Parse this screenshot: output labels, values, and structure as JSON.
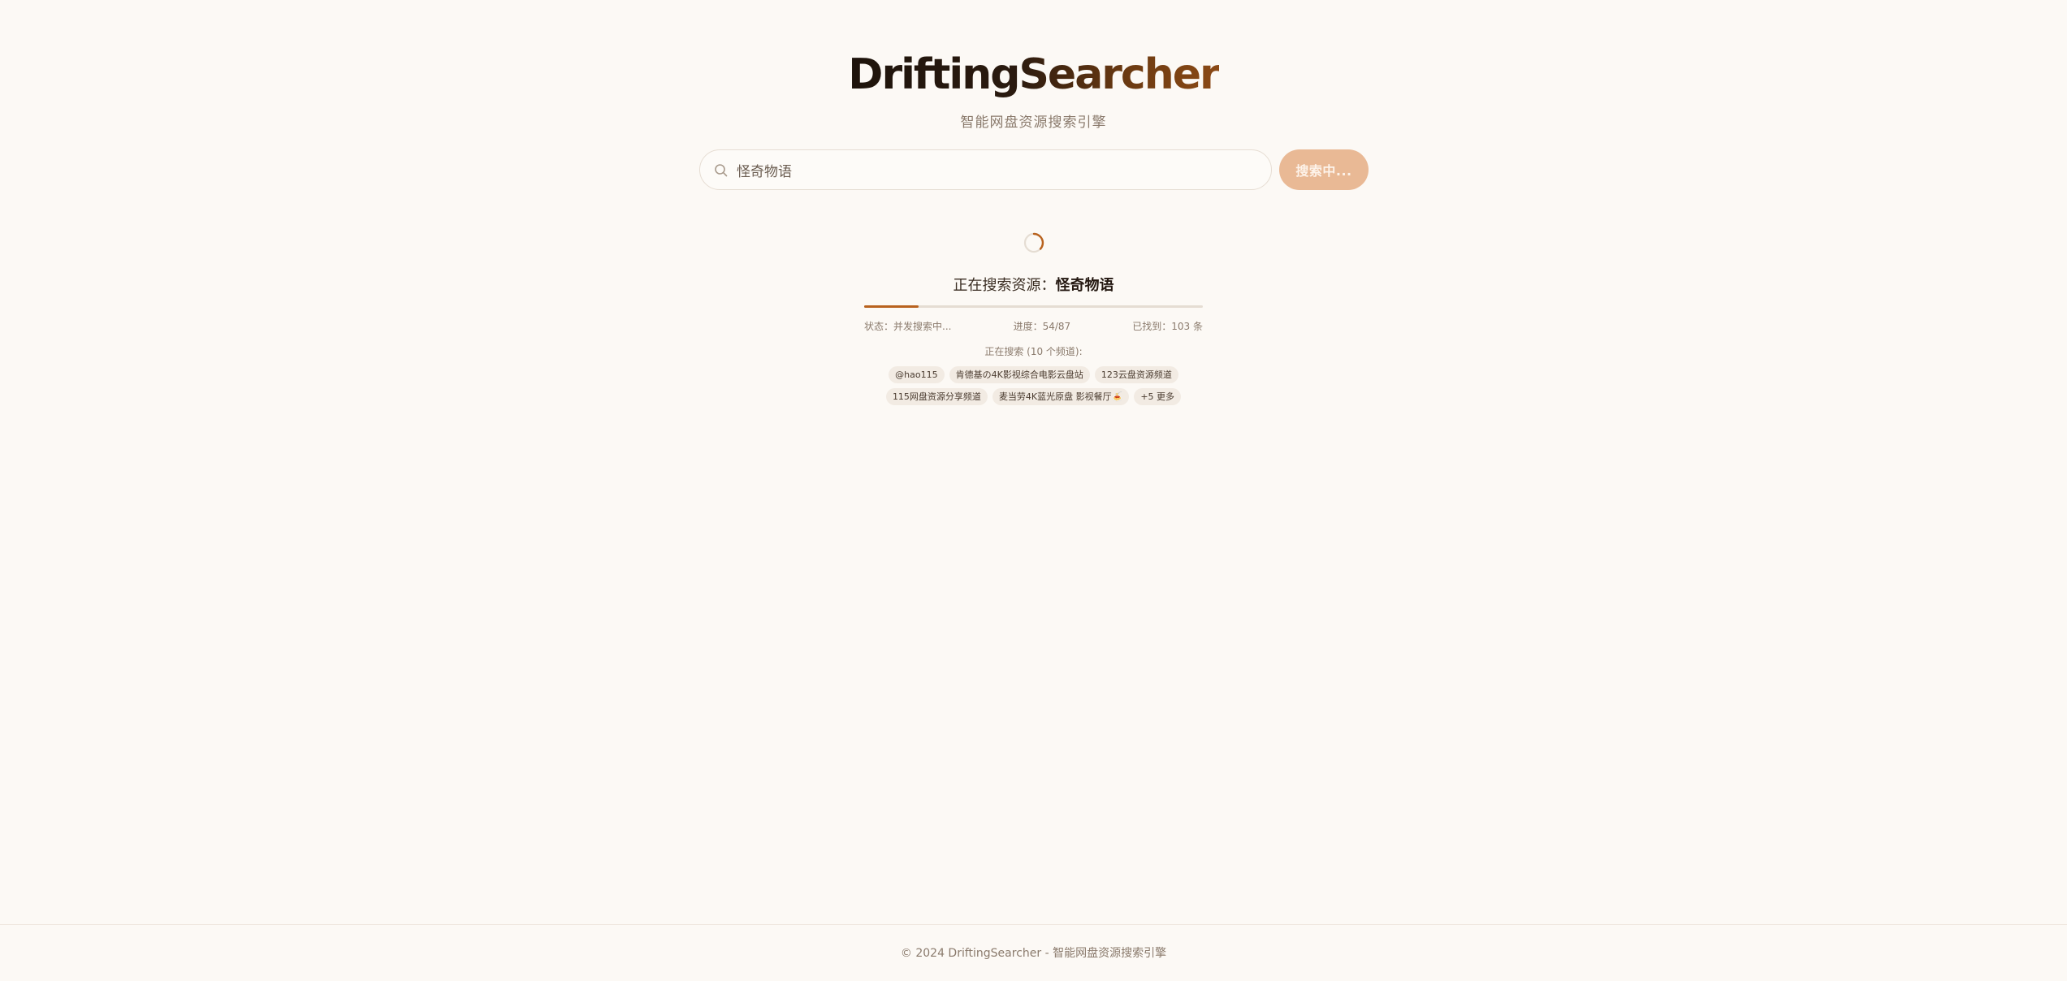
{
  "header": {
    "logo": "DriftingSearcher",
    "subtitle": "智能网盘资源搜索引擎"
  },
  "search": {
    "value": "怪奇物语",
    "button_label": "搜索中..."
  },
  "loading": {
    "prefix": "正在搜索资源：",
    "keyword": "怪奇物语",
    "progress": 0.16
  },
  "stats": {
    "status": "状态：并发搜索中...",
    "progress": "进度：54/87",
    "found": "已找到：103 条"
  },
  "channels": {
    "caption": "正在搜索 (10 个频道):",
    "items": [
      "@hao115",
      "肯德基の4K影视综合电影云盘站",
      "123云盘资源频道",
      "115网盘资源分享频道",
      "麦当劳4K蓝光原盘 影视餐厅🍝",
      "+5 更多"
    ]
  },
  "footer": {
    "text": "© 2024 DriftingSearcher - 智能网盘资源搜索引擎"
  },
  "colors": {
    "accent": "#b8621e",
    "button": "#e9b995",
    "background": "#fcf9f5"
  }
}
